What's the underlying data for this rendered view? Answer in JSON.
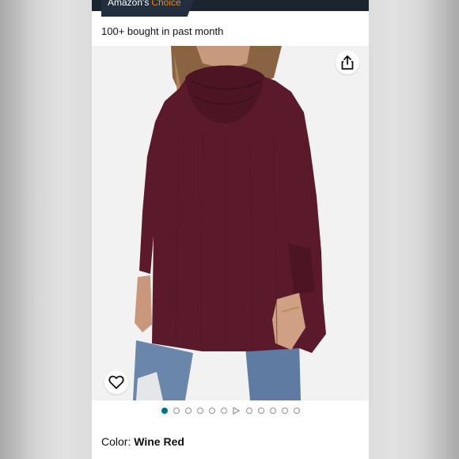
{
  "badge": {
    "part1": "Amazon's",
    "part2": "Choice"
  },
  "bought_text": "100+ bought in past month",
  "gallery": {
    "share_icon": "share-icon",
    "wishlist_icon": "heart-icon",
    "dots": [
      {
        "type": "dot",
        "active": true
      },
      {
        "type": "dot",
        "active": false
      },
      {
        "type": "dot",
        "active": false
      },
      {
        "type": "dot",
        "active": false
      },
      {
        "type": "dot",
        "active": false
      },
      {
        "type": "dot",
        "active": false
      },
      {
        "type": "play",
        "active": false
      },
      {
        "type": "dot",
        "active": false
      },
      {
        "type": "dot",
        "active": false
      },
      {
        "type": "dot",
        "active": false
      },
      {
        "type": "dot",
        "active": false
      },
      {
        "type": "dot",
        "active": false
      }
    ]
  },
  "color": {
    "label": "Color:",
    "value": "Wine Red"
  },
  "colors": {
    "sweater": "#5a1a2c",
    "accent": "#007185",
    "badge": "#232f3e",
    "badge_accent": "#f08804"
  }
}
